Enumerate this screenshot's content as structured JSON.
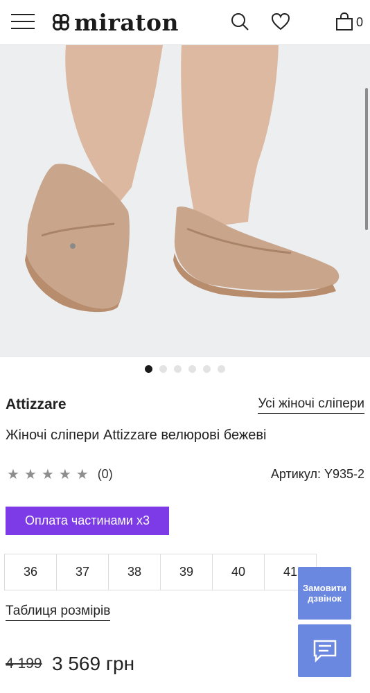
{
  "header": {
    "logo_text": "miraton",
    "cart_count": "0",
    "icons": [
      "menu-icon",
      "logo-clover-icon",
      "search-icon",
      "heart-icon",
      "bag-icon"
    ]
  },
  "gallery": {
    "image_alt": "beige suede loafers on feet",
    "slide_count": 6,
    "active_slide": 1
  },
  "product": {
    "brand": "Attizzare",
    "all_link": "Усі жіночі сліпери",
    "title": "Жіночі сліпери Attizzare велюрові бежеві",
    "rating_stars": 5,
    "reviews": "(0)",
    "sku": "Артикул: Y935-2",
    "pay_button": "Оплата частинами x3",
    "sizes": [
      "36",
      "37",
      "38",
      "39",
      "40",
      "41"
    ],
    "size_table_link": "Таблиця розмірів",
    "old_price": "4 199",
    "new_price": "3 569 грн"
  },
  "widgets": {
    "callback": "Замовити дзвінок"
  },
  "colors": {
    "accent_purple": "#7c3be6",
    "widget_blue": "#6a88e0"
  }
}
